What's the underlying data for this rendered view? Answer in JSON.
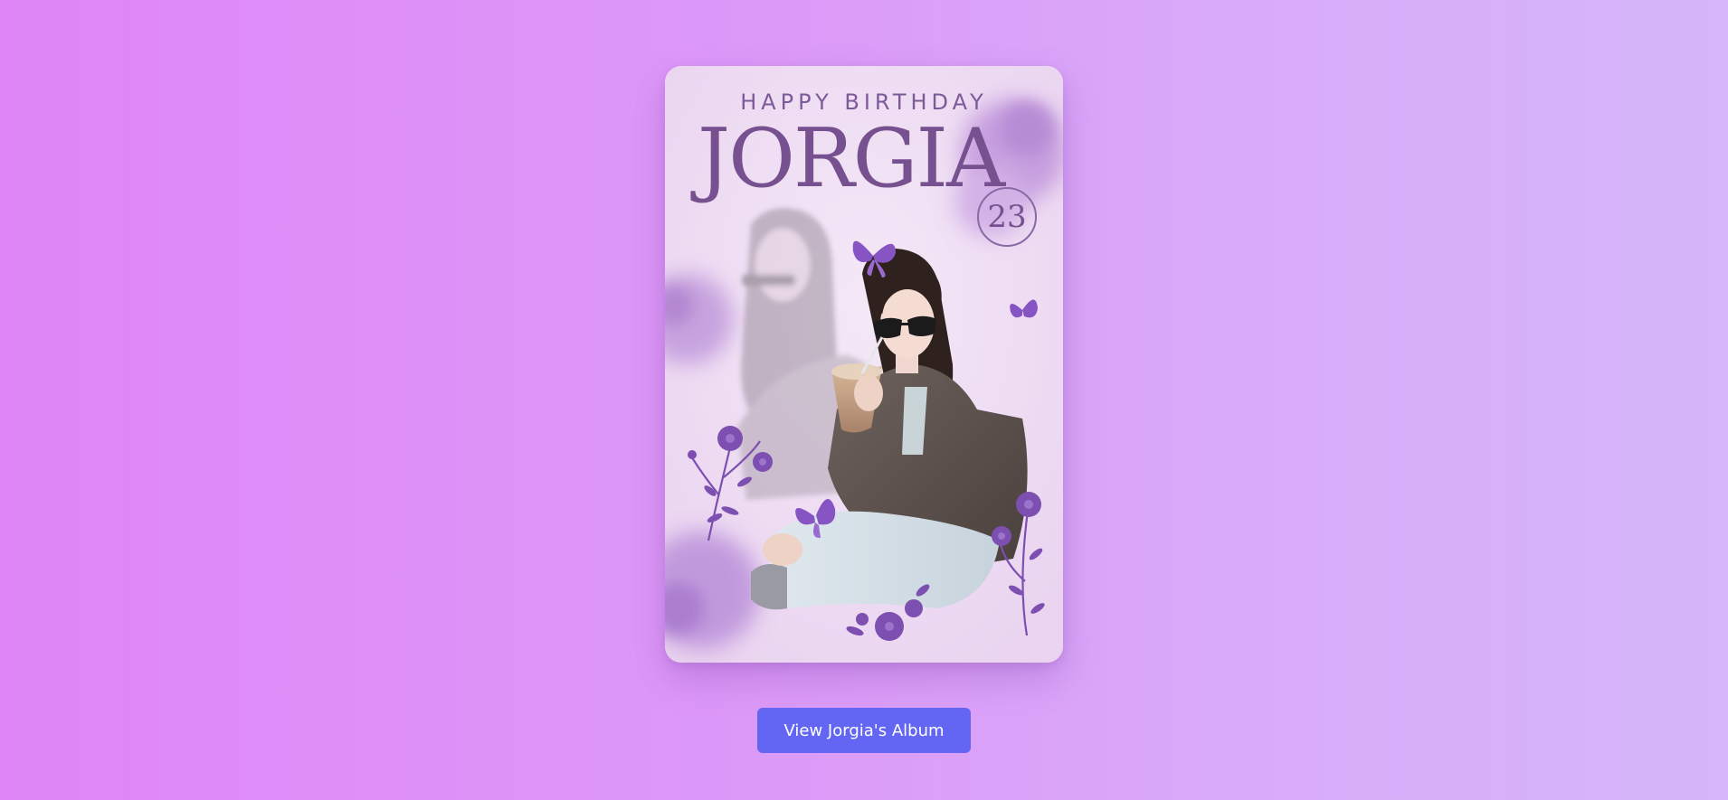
{
  "card": {
    "greeting": "HAPPY BIRTHDAY",
    "name": "JORGIA",
    "age": "23"
  },
  "actions": {
    "album_button_label": "View Jorgia's Album"
  },
  "colors": {
    "background_start": "#df85f7",
    "background_end": "#d5b6fa",
    "card_background": "#efdcf3",
    "title_text": "#76508f",
    "button": "#6366f3",
    "floral_accent": "#7c4fb0"
  }
}
